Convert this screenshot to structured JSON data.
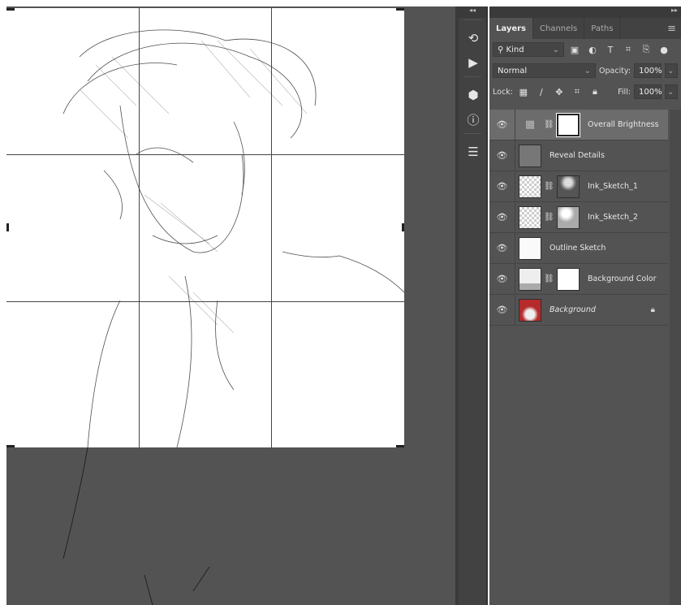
{
  "panel": {
    "collapse_left": "◂◂",
    "collapse_right": "▸▸",
    "tabs": [
      {
        "label": "Layers",
        "active": true
      },
      {
        "label": "Channels"
      },
      {
        "label": "Paths"
      }
    ],
    "filter": {
      "kind": "Kind"
    },
    "blend_mode": "Normal",
    "opacity_label": "Opacity:",
    "opacity": "100%",
    "lock_label": "Lock:",
    "fill_label": "Fill:",
    "fill": "100%",
    "layers": [
      {
        "name": "Overall Brightness",
        "visible": true,
        "selected": true,
        "type": "adjustment-curves"
      },
      {
        "name": "Reveal Details",
        "visible": true
      },
      {
        "name": "Ink_Sketch_1",
        "visible": true,
        "mask": true
      },
      {
        "name": "Ink_Sketch_2",
        "visible": true,
        "mask": true
      },
      {
        "name": "Outline Sketch",
        "visible": true
      },
      {
        "name": "Background Color",
        "visible": true,
        "mask": true
      },
      {
        "name": "Background",
        "visible": true,
        "locked": true,
        "italic": true
      }
    ]
  },
  "colors": {
    "panel": "#535353",
    "selected": "#6c6c6c",
    "dark": "#424242"
  }
}
